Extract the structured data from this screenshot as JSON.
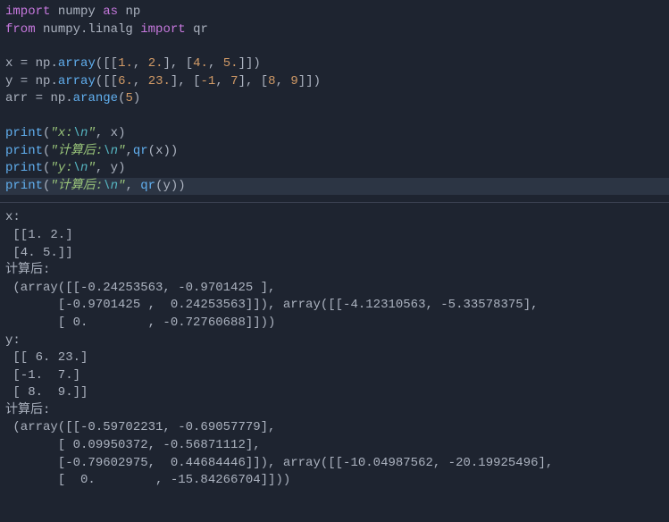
{
  "code": {
    "line1": {
      "kw1": "import",
      "mod1": "numpy",
      "kw2": "as",
      "alias": "np"
    },
    "line2": {
      "kw1": "from",
      "mod1": "numpy.linalg",
      "kw2": "import",
      "func": "qr"
    },
    "line4": {
      "var": "x",
      "eq": " = ",
      "np": "np",
      "dot": ".",
      "fn": "array",
      "args": "([[1., 2.], [4., 5.]])"
    },
    "line5": {
      "var": "y",
      "eq": " = ",
      "np": "np",
      "dot": ".",
      "fn": "array",
      "args": "([[6., 23.], [-1, 7], [8, 9]])"
    },
    "line6": {
      "var": "arr",
      "eq": " = ",
      "np": "np",
      "dot": ".",
      "fn": "arange",
      "args": "(5)"
    },
    "line8": {
      "fn": "print",
      "str1": "\"x:",
      "esc": "\\n",
      "str2": "\"",
      "arg2": ", x)"
    },
    "line9": {
      "fn": "print",
      "str1": "\"计算后:",
      "esc": "\\n",
      "str2": "\"",
      "arg2": ",qr(x))"
    },
    "line10": {
      "fn": "print",
      "str1": "\"y:",
      "esc": "\\n",
      "str2": "\"",
      "arg2": ", y)"
    },
    "line11": {
      "fn": "print",
      "str1": "\"计算后:",
      "esc": "\\n",
      "str2": "\"",
      "arg2": ", qr(y))"
    }
  },
  "output": {
    "l1": "x:",
    "l2": " [[1. 2.]",
    "l3": " [4. 5.]]",
    "l4": "计算后:",
    "l5": " (array([[-0.24253563, -0.9701425 ],",
    "l6": "       [-0.9701425 ,  0.24253563]]), array([[-4.12310563, -5.33578375],",
    "l7": "       [ 0.        , -0.72760688]]))",
    "l8": "y:",
    "l9": " [[ 6. 23.]",
    "l10": " [-1.  7.]",
    "l11": " [ 8.  9.]]",
    "l12": "计算后:",
    "l13": " (array([[-0.59702231, -0.69057779],",
    "l14": "       [ 0.09950372, -0.56871112],",
    "l15": "       [-0.79602975,  0.44684446]]), array([[-10.04987562, -20.19925496],",
    "l16": "       [  0.        , -15.84266704]]))"
  }
}
